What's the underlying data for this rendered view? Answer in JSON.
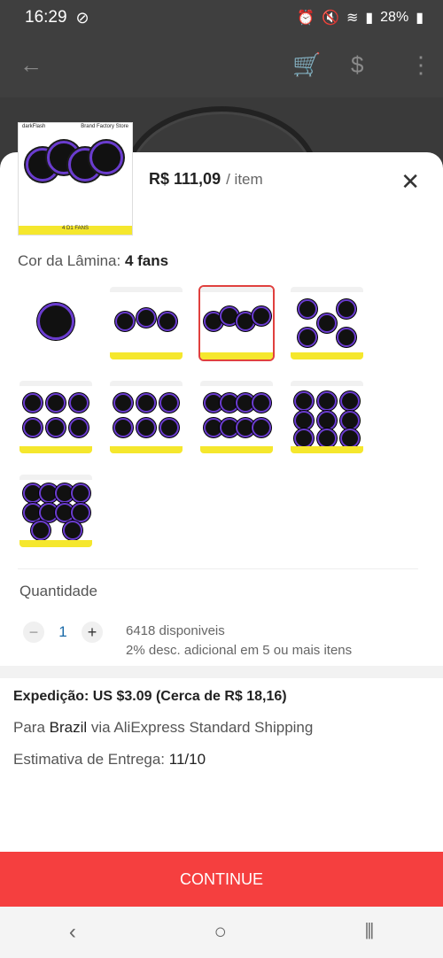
{
  "status": {
    "time": "16:29",
    "battery": "28%"
  },
  "product": {
    "price": "R$ 111,09",
    "unit": "/ item",
    "thumb_brand": "darkFlash",
    "thumb_store": "Brand Factory Store",
    "thumb_strip": "4 D1 FANS"
  },
  "color": {
    "label": "Cor da Lâmina:",
    "value": "4 fans"
  },
  "quantity": {
    "label": "Quantidade",
    "value": "1",
    "available": "6418 disponiveis",
    "discount": "2% desc. adicional em 5 ou mais itens"
  },
  "shipping": {
    "title": "Expedição: US $3.09 (Cerca de R$ 18,16)",
    "to_prefix": "Para",
    "to_country": "Brazil",
    "to_suffix": "via AliExpress Standard Shipping",
    "eta_label": "Estimativa de Entrega:",
    "eta_value": "11/10"
  },
  "actions": {
    "continue": "CONTINUE"
  },
  "options": [
    {
      "name": "1 fan"
    },
    {
      "name": "3 fans"
    },
    {
      "name": "4 fans",
      "selected": true
    },
    {
      "name": "5 fans"
    },
    {
      "name": "6 fans"
    },
    {
      "name": "7 fans"
    },
    {
      "name": "8 fans"
    },
    {
      "name": "9 fans"
    },
    {
      "name": "10 fans"
    }
  ]
}
